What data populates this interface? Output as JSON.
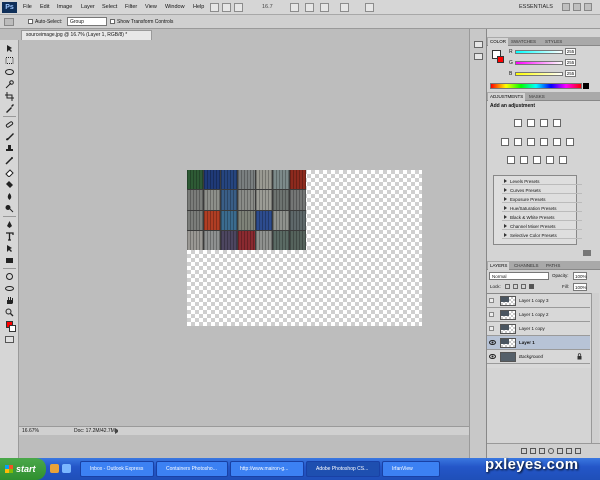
{
  "app": {
    "logo": "Ps"
  },
  "menu": [
    "File",
    "Edit",
    "Image",
    "Layer",
    "Select",
    "Filter",
    "View",
    "Window",
    "Help"
  ],
  "header": {
    "zoom": "16.7",
    "workspace": "ESSENTIALS"
  },
  "options_bar": {
    "auto_select_label": "Auto-Select:",
    "auto_select_value": "Group",
    "transform_label": "Show Transform Controls"
  },
  "document": {
    "tab_title": "sourceimage.jpg @ 16.7% (Layer 1, RGB/8) *"
  },
  "status": {
    "zoom": "16.67%",
    "doc": "Doc: 17.2M/42.7M"
  },
  "color_panel": {
    "tabs": [
      "COLOR",
      "SWATCHES",
      "STYLES"
    ],
    "channels": [
      {
        "label": "R",
        "value": "255"
      },
      {
        "label": "G",
        "value": "255"
      },
      {
        "label": "B",
        "value": "255"
      }
    ],
    "fg_color": "#ff0000",
    "bg_color": "#ffffff"
  },
  "adjustments_panel": {
    "tabs": [
      "ADJUSTMENTS",
      "MASKS"
    ],
    "heading": "Add an adjustment",
    "presets": [
      "Levels Presets",
      "Curves Presets",
      "Exposure Presets",
      "Hue/Saturation Presets",
      "Black & White Presets",
      "Channel Mixer Presets",
      "Selective Color Presets"
    ]
  },
  "layers_panel": {
    "tabs": [
      "LAYERS",
      "CHANNELS",
      "PATHS"
    ],
    "blend_mode": "Normal",
    "opacity_label": "Opacity:",
    "opacity": "100%",
    "lock_label": "Lock:",
    "fill_label": "Fill:",
    "fill": "100%",
    "layers": [
      {
        "name": "Layer 1 copy 3"
      },
      {
        "name": "Layer 1 copy 2"
      },
      {
        "name": "Layer 1 copy"
      },
      {
        "name": "Layer 1"
      },
      {
        "name": "Background"
      }
    ]
  },
  "taskbar": {
    "start": "start",
    "items": [
      "Inbox - Outlook Express",
      "Containers Photosho...",
      "http://www.mairon-g...",
      "Adobe Photoshop CS...",
      "IrfanView"
    ]
  },
  "watermark": "pxleyes.com",
  "photo_colors": [
    "#2e5a35",
    "#1f3a78",
    "#26457f",
    "#7a7f80",
    "#9a9a92",
    "#7c8a8a",
    "#8d2a1e",
    "#7a7c79",
    "#8d8f8a",
    "#3a5e86",
    "#8a8c88",
    "#9b9c95",
    "#6d7370",
    "#747675",
    "#7b7d7a",
    "#b03e24",
    "#3b6b8e",
    "#7e8278",
    "#2d4c8e",
    "#8f918d",
    "#5e686a",
    "#9a9894",
    "#8e9090",
    "#4d4660",
    "#8a2a30",
    "#8f918e",
    "#5a6a64",
    "#55635c"
  ]
}
